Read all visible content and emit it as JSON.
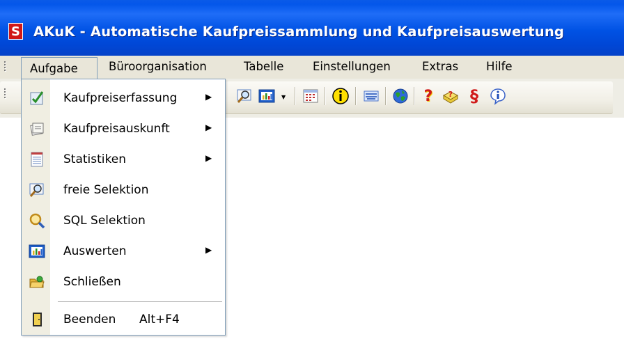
{
  "window": {
    "title": "AKuK - Automatische Kaufpreissammlung und Kaufpreisauswertung",
    "app_icon": "S"
  },
  "menubar": {
    "items": [
      "Aufgabe",
      "Büroorganisation",
      "Tabelle",
      "Einstellungen",
      "Extras",
      "Hilfe"
    ]
  },
  "toolbar": {
    "buttons": [
      "search-icon",
      "chart-icon",
      "calendar-icon",
      "info-icon",
      "keyboard-icon",
      "globe-icon",
      "help-icon",
      "book-help-icon",
      "paragraph-icon",
      "info-about-icon"
    ],
    "paragraph_glyph": "§"
  },
  "dropdown": {
    "items": [
      {
        "label": "Kaufpreiserfassung",
        "icon": "form-check-icon",
        "submenu": true
      },
      {
        "label": "Kaufpreisauskunft",
        "icon": "document-stack-icon",
        "submenu": true
      },
      {
        "label": "Statistiken",
        "icon": "statistics-sheet-icon",
        "submenu": true
      },
      {
        "label": "freie Selektion",
        "icon": "magnifier-window-icon",
        "submenu": false
      },
      {
        "label": "SQL Selektion",
        "icon": "magnifier-icon",
        "submenu": false
      },
      {
        "label": "Auswerten",
        "icon": "bar-chart-icon",
        "submenu": true
      },
      {
        "label": "Schließen",
        "icon": "folder-close-icon",
        "submenu": false
      },
      {
        "label": "Beenden",
        "icon": "exit-door-icon",
        "submenu": false,
        "shortcut": "Alt+F4"
      }
    ]
  },
  "colors": {
    "titlebar": "#0052e4",
    "menubar": "#e9e6d9",
    "toolbar": "#f1efe6",
    "menu_border": "#7f9db9"
  }
}
